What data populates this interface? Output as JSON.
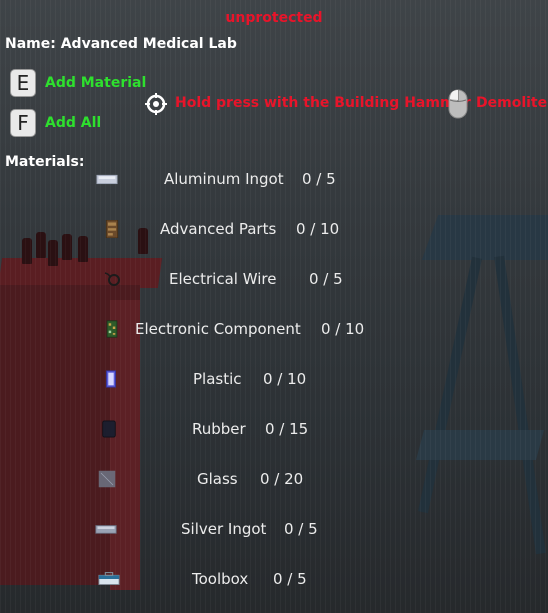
{
  "status": "unprotected",
  "name_text": "Name: Advanced Medical Lab",
  "actions": [
    {
      "key": "E",
      "label": "Add Material"
    },
    {
      "key": "F",
      "label": "Add All"
    }
  ],
  "hints": {
    "hold_press": "Hold press with the Building Hammer",
    "demolite": "Demolite"
  },
  "materials_title": "Materials:",
  "materials": [
    {
      "name": "Aluminum Ingot",
      "count": "0 / 5",
      "icon": "aluminum-ingot-icon"
    },
    {
      "name": "Advanced Parts",
      "count": "0 / 10",
      "icon": "advanced-parts-icon"
    },
    {
      "name": "Electrical Wire",
      "count": "0 / 5",
      "icon": "electrical-wire-icon"
    },
    {
      "name": "Electronic Component",
      "count": "0 / 10",
      "icon": "electronic-component-icon"
    },
    {
      "name": "Plastic",
      "count": "0 / 10",
      "icon": "plastic-icon"
    },
    {
      "name": "Rubber",
      "count": "0 / 15",
      "icon": "rubber-icon"
    },
    {
      "name": "Glass",
      "count": "0 / 20",
      "icon": "glass-icon"
    },
    {
      "name": "Silver Ingot",
      "count": "0 / 5",
      "icon": "silver-ingot-icon"
    },
    {
      "name": "Toolbox",
      "count": "0 / 5",
      "icon": "toolbox-icon"
    }
  ],
  "colors": {
    "status": "#e8142a",
    "action": "#2ee02e",
    "hint": "#e8142a",
    "text": "#ececec"
  }
}
